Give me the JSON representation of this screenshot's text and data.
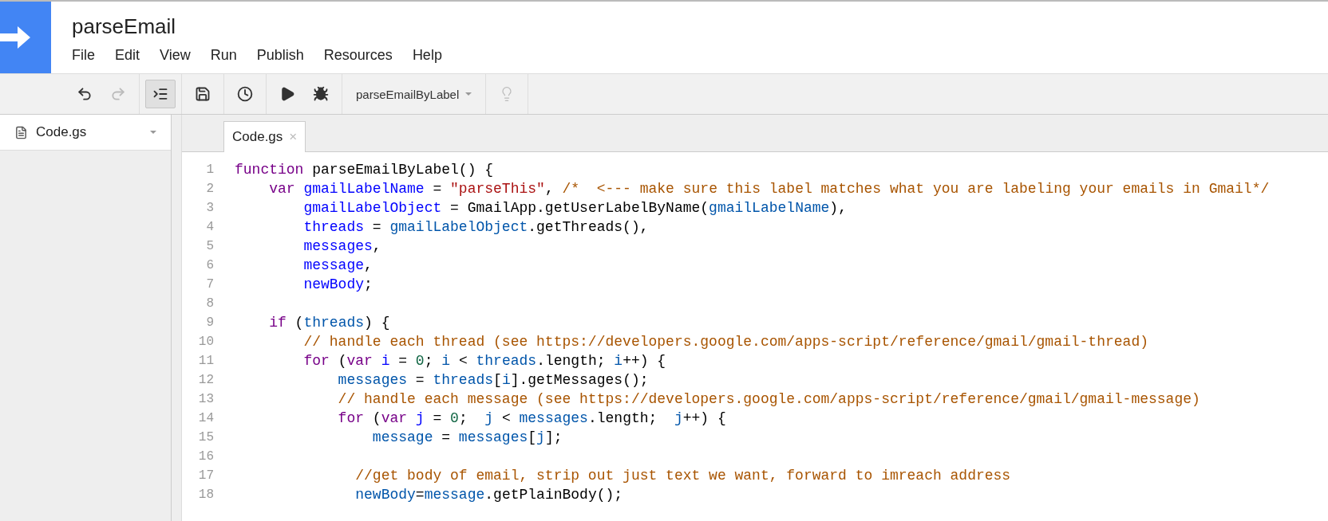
{
  "project": {
    "title": "parseEmail"
  },
  "menu": [
    "File",
    "Edit",
    "View",
    "Run",
    "Publish",
    "Resources",
    "Help"
  ],
  "toolbar": [
    [
      {
        "kind": "undo",
        "disabled": false,
        "pressed": false
      },
      {
        "kind": "redo",
        "disabled": true,
        "pressed": false
      }
    ],
    [
      {
        "kind": "indent",
        "disabled": false,
        "pressed": true
      }
    ],
    [
      {
        "kind": "save",
        "disabled": false,
        "pressed": false
      }
    ],
    [
      {
        "kind": "triggers",
        "disabled": false,
        "pressed": false
      }
    ],
    [
      {
        "kind": "run",
        "disabled": false,
        "pressed": false
      },
      {
        "kind": "debug",
        "disabled": false,
        "pressed": false
      }
    ],
    [
      {
        "kind": "select",
        "label": "parseEmailByLabel"
      }
    ],
    [
      {
        "kind": "hint",
        "disabled": true,
        "pressed": false
      }
    ]
  ],
  "sidebar": {
    "files": [
      {
        "name": "Code.gs",
        "selected": true
      }
    ]
  },
  "tabs": [
    {
      "label": "Code.gs",
      "close": "×",
      "selected": true
    }
  ],
  "code": [
    {
      "number": "1",
      "tokens": [
        {
          "kind": "keyword",
          "text": "function"
        },
        {
          "kind": "plain",
          "text": " parseEmailByLabel() {"
        }
      ]
    },
    {
      "number": "2",
      "tokens": [
        {
          "kind": "keyword",
          "text": "    var"
        },
        {
          "kind": "def",
          "text": " gmailLabelName"
        },
        {
          "kind": "plain",
          "text": " = "
        },
        {
          "kind": "string",
          "text": "\"parseThis\""
        },
        {
          "kind": "plain",
          "text": ", "
        },
        {
          "kind": "comment",
          "text": "/*  <--- make sure this label matches what you are labeling your emails in Gmail*/"
        }
      ]
    },
    {
      "number": "3",
      "tokens": [
        {
          "kind": "def",
          "text": "        gmailLabelObject"
        },
        {
          "kind": "plain",
          "text": " = GmailApp.getUserLabelByName("
        },
        {
          "kind": "variable",
          "text": "gmailLabelName"
        },
        {
          "kind": "plain",
          "text": "),"
        }
      ]
    },
    {
      "number": "4",
      "tokens": [
        {
          "kind": "def",
          "text": "        threads"
        },
        {
          "kind": "plain",
          "text": " = "
        },
        {
          "kind": "variable",
          "text": "gmailLabelObject"
        },
        {
          "kind": "plain",
          "text": ".getThreads(),"
        }
      ]
    },
    {
      "number": "5",
      "tokens": [
        {
          "kind": "def",
          "text": "        messages"
        },
        {
          "kind": "plain",
          "text": ","
        }
      ]
    },
    {
      "number": "6",
      "tokens": [
        {
          "kind": "def",
          "text": "        message"
        },
        {
          "kind": "plain",
          "text": ","
        }
      ]
    },
    {
      "number": "7",
      "tokens": [
        {
          "kind": "def",
          "text": "        newBody"
        },
        {
          "kind": "plain",
          "text": ";"
        }
      ]
    },
    {
      "number": "8"
    },
    {
      "number": "9",
      "tokens": [
        {
          "kind": "keyword",
          "text": "    if"
        },
        {
          "kind": "plain",
          "text": " ("
        },
        {
          "kind": "variable",
          "text": "threads"
        },
        {
          "kind": "plain",
          "text": ") {"
        }
      ]
    },
    {
      "number": "10",
      "tokens": [
        {
          "kind": "comment",
          "text": "        // handle each thread (see https://developers.google.com/apps-script/reference/gmail/gmail-thread)"
        }
      ]
    },
    {
      "number": "11",
      "tokens": [
        {
          "kind": "keyword",
          "text": "        for"
        },
        {
          "kind": "plain",
          "text": " ("
        },
        {
          "kind": "keyword",
          "text": "var"
        },
        {
          "kind": "def",
          "text": " i"
        },
        {
          "kind": "plain",
          "text": " = "
        },
        {
          "kind": "number",
          "text": "0"
        },
        {
          "kind": "plain",
          "text": "; "
        },
        {
          "kind": "variable",
          "text": "i"
        },
        {
          "kind": "plain",
          "text": " < "
        },
        {
          "kind": "variable",
          "text": "threads"
        },
        {
          "kind": "plain",
          "text": ".length; "
        },
        {
          "kind": "variable",
          "text": "i"
        },
        {
          "kind": "plain",
          "text": "++) {"
        }
      ]
    },
    {
      "number": "12",
      "tokens": [
        {
          "kind": "variable",
          "text": "            messages"
        },
        {
          "kind": "plain",
          "text": " = "
        },
        {
          "kind": "variable",
          "text": "threads"
        },
        {
          "kind": "plain",
          "text": "["
        },
        {
          "kind": "variable",
          "text": "i"
        },
        {
          "kind": "plain",
          "text": "].getMessages();"
        }
      ]
    },
    {
      "number": "13",
      "tokens": [
        {
          "kind": "comment",
          "text": "            // handle each message (see https://developers.google.com/apps-script/reference/gmail/gmail-message)"
        }
      ]
    },
    {
      "number": "14",
      "tokens": [
        {
          "kind": "keyword",
          "text": "            for"
        },
        {
          "kind": "plain",
          "text": " ("
        },
        {
          "kind": "keyword",
          "text": "var"
        },
        {
          "kind": "def",
          "text": " j"
        },
        {
          "kind": "plain",
          "text": " = "
        },
        {
          "kind": "number",
          "text": "0"
        },
        {
          "kind": "plain",
          "text": ";  "
        },
        {
          "kind": "variable",
          "text": "j"
        },
        {
          "kind": "plain",
          "text": " < "
        },
        {
          "kind": "variable",
          "text": "messages"
        },
        {
          "kind": "plain",
          "text": ".length;  "
        },
        {
          "kind": "variable",
          "text": "j"
        },
        {
          "kind": "plain",
          "text": "++) {"
        }
      ]
    },
    {
      "number": "15",
      "tokens": [
        {
          "kind": "variable",
          "text": "                message"
        },
        {
          "kind": "plain",
          "text": " = "
        },
        {
          "kind": "variable",
          "text": "messages"
        },
        {
          "kind": "plain",
          "text": "["
        },
        {
          "kind": "variable",
          "text": "j"
        },
        {
          "kind": "plain",
          "text": "];"
        }
      ]
    },
    {
      "number": "16"
    },
    {
      "number": "17",
      "tokens": [
        {
          "kind": "comment",
          "text": "              //get body of email, strip out just text we want, forward to imreach address"
        }
      ]
    },
    {
      "number": "18",
      "tokens": [
        {
          "kind": "variable",
          "text": "              newBody"
        },
        {
          "kind": "plain",
          "text": "="
        },
        {
          "kind": "variable",
          "text": "message"
        },
        {
          "kind": "plain",
          "text": ".getPlainBody();"
        }
      ]
    }
  ]
}
